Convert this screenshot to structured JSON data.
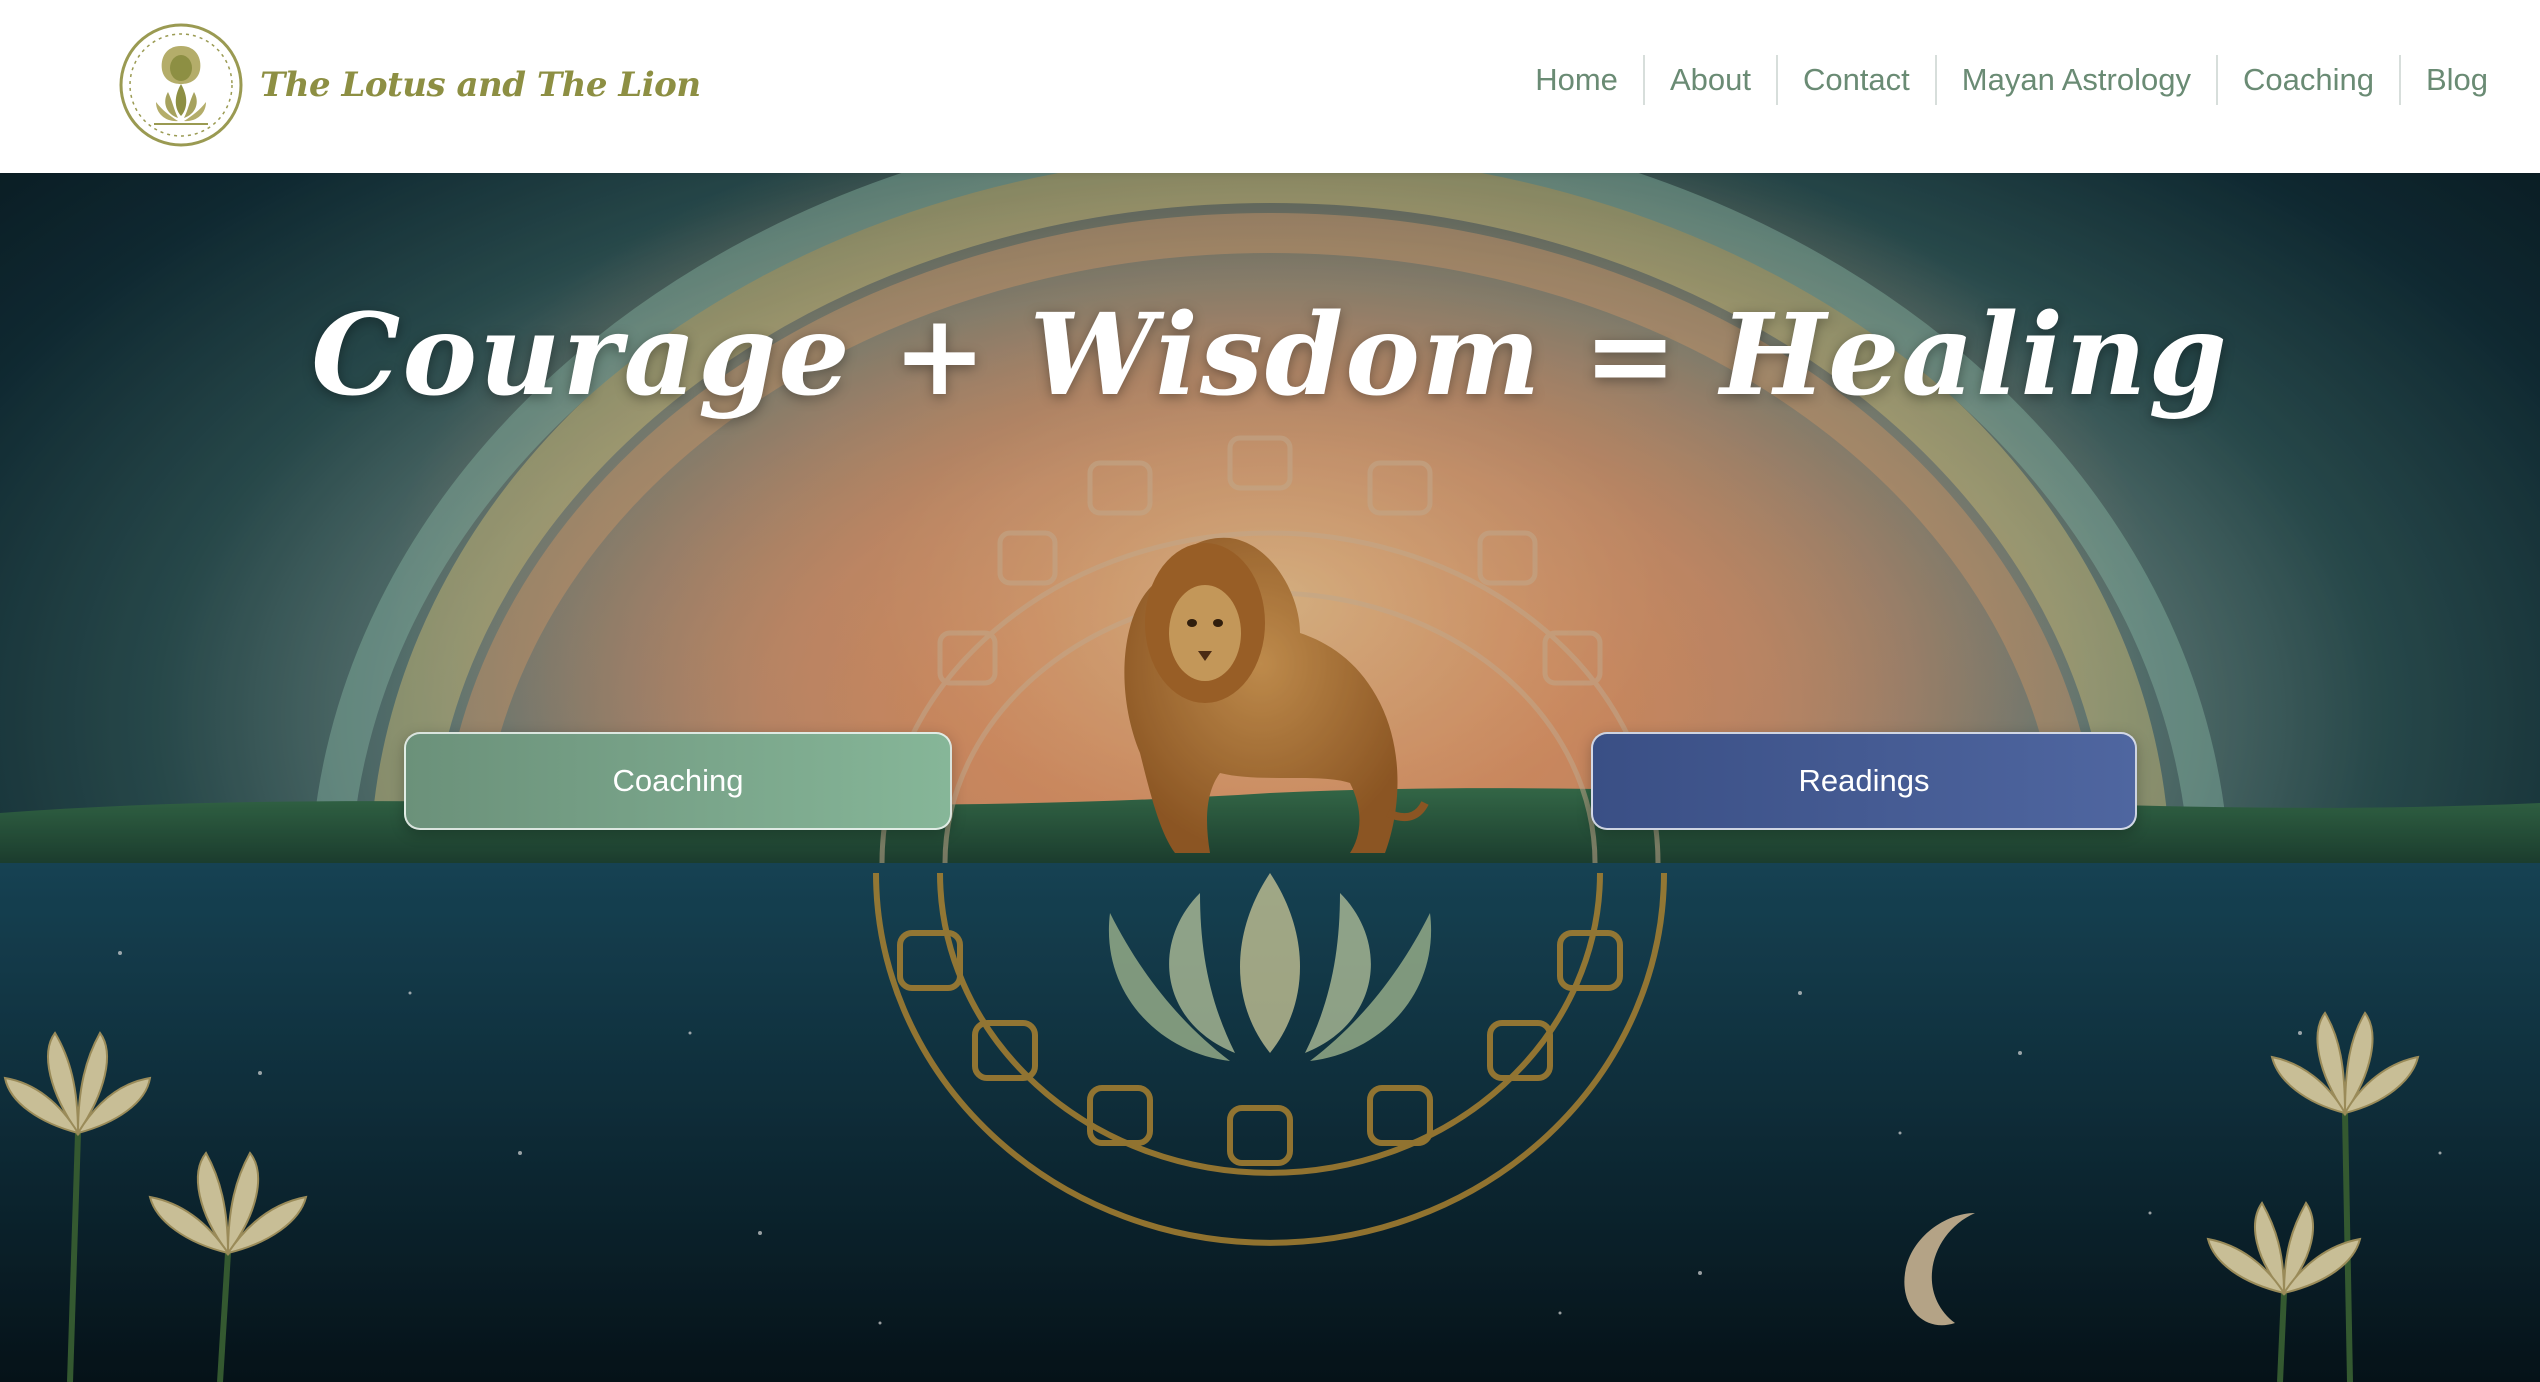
{
  "brand": {
    "name": "The Lotus and The Lion",
    "logo_icon": "lion-lotus-emblem-icon",
    "color": "#8d8f43"
  },
  "nav": {
    "items": [
      {
        "label": "Home"
      },
      {
        "label": "About"
      },
      {
        "label": "Contact"
      },
      {
        "label": "Mayan Astrology"
      },
      {
        "label": "Coaching"
      },
      {
        "label": "Blog"
      }
    ],
    "color": "#6a8b74"
  },
  "hero": {
    "headline": "Courage  +  Wisdom = Healing",
    "buttons": {
      "coaching": {
        "label": "Coaching",
        "color": "#7aa58a"
      },
      "readings": {
        "label": "Readings",
        "color": "#465c95"
      }
    },
    "artwork": {
      "elements": [
        "rainbow-arch",
        "lion-icon",
        "mayan-glyph-ring",
        "lotus-flower-icon",
        "crescent-moon-icon",
        "water-lily-icons"
      ]
    }
  }
}
